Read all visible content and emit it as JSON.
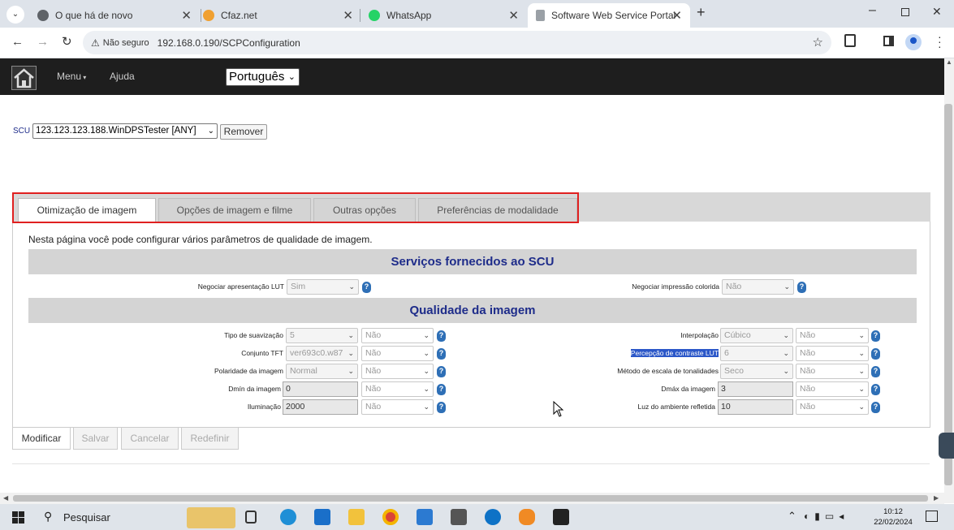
{
  "browser": {
    "tabs": [
      {
        "title": "O que há de novo",
        "color": "#5f6368"
      },
      {
        "title": "Cfaz.net",
        "color": "#f0a030"
      },
      {
        "title": "WhatsApp",
        "color": "#25d366"
      },
      {
        "title": "Software Web Service Portal",
        "color": "#9aa0a6"
      }
    ],
    "security_label": "Não seguro",
    "url": "192.168.0.190/SCPConfiguration"
  },
  "nav": {
    "menu": "Menu",
    "help": "Ajuda",
    "language": "Português"
  },
  "scu": {
    "label": "SCU",
    "value": "123.123.123.188.WinDPSTester [ANY]",
    "remove": "Remover"
  },
  "tabs": [
    "Otimização de imagem",
    "Opções de imagem e filme",
    "Outras opções",
    "Preferências de modalidade"
  ],
  "intro": "Nesta página você pode configurar vários parâmetros de qualidade de imagem.",
  "section1": {
    "title": "Serviços fornecidos ao SCU",
    "left": {
      "label": "Negociar apresentação LUT",
      "value": "Sim"
    },
    "right": {
      "label": "Negociar impressão colorida",
      "value": "Não"
    }
  },
  "section2": {
    "title": "Qualidade da imagem",
    "left": [
      {
        "label": "Tipo de suavização",
        "value": "5",
        "opt": "Não"
      },
      {
        "label": "Conjunto TFT",
        "value": "ver693c0.w87",
        "opt": "Não"
      },
      {
        "label": "Polaridade da imagem",
        "value": "Normal",
        "opt": "Não"
      },
      {
        "label": "Dmín da imagem",
        "value": "0",
        "opt": "Não"
      },
      {
        "label": "Iluminação",
        "value": "2000",
        "opt": "Não"
      }
    ],
    "right": [
      {
        "label": "Interpolação",
        "value": "Cúbico",
        "opt": "Não"
      },
      {
        "label": "Percepção de contraste LUT",
        "value": "6",
        "opt": "Não"
      },
      {
        "label": "Método de escala de tonalidades",
        "value": "Seco",
        "opt": "Não"
      },
      {
        "label": "Dmáx da imagem",
        "value": "3",
        "opt": "Não"
      },
      {
        "label": "Luz do ambiente refletida",
        "value": "10",
        "opt": "Não"
      }
    ]
  },
  "buttons": {
    "modify": "Modificar",
    "save": "Salvar",
    "cancel": "Cancelar",
    "reset": "Redefinir"
  },
  "taskbar": {
    "search": "Pesquisar",
    "time": "10:12",
    "date": "22/02/2024"
  },
  "colors": {
    "accent_red": "#e02020",
    "section_title": "#1e2c8a"
  }
}
